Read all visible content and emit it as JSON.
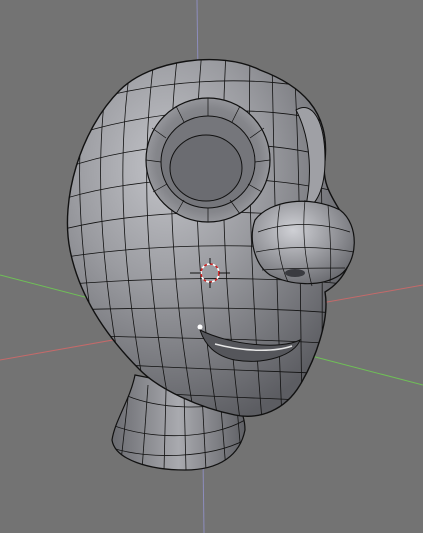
{
  "viewport": {
    "background": "#737373",
    "view": "3d-viewport-perspective",
    "mode": "edit-mode-wireframe-overlay"
  },
  "axes": {
    "x_color": "#c46a6a",
    "y_color": "#6fbf57",
    "z_color": "#8d8dbd"
  },
  "mesh": {
    "object": "cartoon-head-with-neck",
    "shading": "smooth-gray",
    "base_color": "#8e8f94",
    "wire_color": "#111111"
  },
  "cursor": {
    "icon": "3d-cursor-icon",
    "ring_color": "#cc2222"
  },
  "selected_vertex": {
    "color": "#ffffff"
  }
}
